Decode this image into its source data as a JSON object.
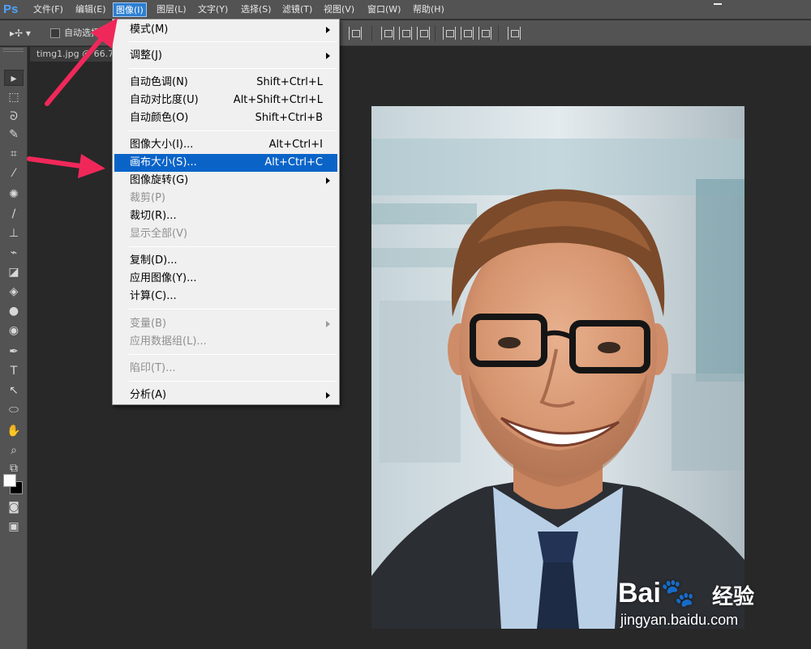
{
  "app": {
    "logo": "Ps"
  },
  "menubar": {
    "items": [
      {
        "label": "文件(F)"
      },
      {
        "label": "编辑(E)"
      },
      {
        "label": "图像(I)"
      },
      {
        "label": "图层(L)"
      },
      {
        "label": "文字(Y)"
      },
      {
        "label": "选择(S)"
      },
      {
        "label": "滤镜(T)"
      },
      {
        "label": "视图(V)"
      },
      {
        "label": "窗口(W)"
      },
      {
        "label": "帮助(H)"
      }
    ],
    "active_index": 2
  },
  "options_bar": {
    "tool_glyph": "▸✢ ▾",
    "auto_select_label": "自动选择"
  },
  "document_tab": {
    "label": "timg1.jpg @ 66.7%"
  },
  "image_menu": {
    "items": [
      {
        "label": "模式(M)",
        "shortcut": "",
        "submenu": true,
        "disabled": false
      },
      {
        "label": "调整(J)",
        "shortcut": "",
        "submenu": true,
        "disabled": false
      },
      {
        "label": "自动色调(N)",
        "shortcut": "Shift+Ctrl+L",
        "submenu": false,
        "disabled": false
      },
      {
        "label": "自动对比度(U)",
        "shortcut": "Alt+Shift+Ctrl+L",
        "submenu": false,
        "disabled": false
      },
      {
        "label": "自动颜色(O)",
        "shortcut": "Shift+Ctrl+B",
        "submenu": false,
        "disabled": false
      },
      {
        "label": "图像大小(I)...",
        "shortcut": "Alt+Ctrl+I",
        "submenu": false,
        "disabled": false
      },
      {
        "label": "画布大小(S)...",
        "shortcut": "Alt+Ctrl+C",
        "submenu": false,
        "disabled": false,
        "highlighted": true
      },
      {
        "label": "图像旋转(G)",
        "shortcut": "",
        "submenu": true,
        "disabled": false
      },
      {
        "label": "裁剪(P)",
        "shortcut": "",
        "submenu": false,
        "disabled": true
      },
      {
        "label": "裁切(R)...",
        "shortcut": "",
        "submenu": false,
        "disabled": false
      },
      {
        "label": "显示全部(V)",
        "shortcut": "",
        "submenu": false,
        "disabled": true
      },
      {
        "label": "复制(D)...",
        "shortcut": "",
        "submenu": false,
        "disabled": false
      },
      {
        "label": "应用图像(Y)...",
        "shortcut": "",
        "submenu": false,
        "disabled": false
      },
      {
        "label": "计算(C)...",
        "shortcut": "",
        "submenu": false,
        "disabled": false
      },
      {
        "label": "变量(B)",
        "shortcut": "",
        "submenu": true,
        "disabled": true
      },
      {
        "label": "应用数据组(L)...",
        "shortcut": "",
        "submenu": false,
        "disabled": true
      },
      {
        "label": "陷印(T)...",
        "shortcut": "",
        "submenu": false,
        "disabled": true
      },
      {
        "label": "分析(A)",
        "shortcut": "",
        "submenu": true,
        "disabled": false
      }
    ]
  },
  "tools": [
    {
      "name": "move-tool-icon",
      "glyph": "▸"
    },
    {
      "name": "marquee-tool-icon",
      "glyph": "⬚"
    },
    {
      "name": "lasso-tool-icon",
      "glyph": "ᘐ"
    },
    {
      "name": "quick-select-tool-icon",
      "glyph": "✎"
    },
    {
      "name": "crop-tool-icon",
      "glyph": "⌗"
    },
    {
      "name": "eyedropper-tool-icon",
      "glyph": "⁄"
    },
    {
      "name": "healing-brush-icon",
      "glyph": "✺"
    },
    {
      "name": "brush-tool-icon",
      "glyph": "∕"
    },
    {
      "name": "stamp-tool-icon",
      "glyph": "⊥"
    },
    {
      "name": "history-brush-icon",
      "glyph": "⌁"
    },
    {
      "name": "eraser-tool-icon",
      "glyph": "◪"
    },
    {
      "name": "paint-bucket-icon",
      "glyph": "◈"
    },
    {
      "name": "blur-tool-icon",
      "glyph": "●"
    },
    {
      "name": "dodge-tool-icon",
      "glyph": "◉"
    },
    {
      "name": "pen-tool-icon",
      "glyph": "✒"
    },
    {
      "name": "type-tool-icon",
      "glyph": "T"
    },
    {
      "name": "path-select-icon",
      "glyph": "↖"
    },
    {
      "name": "ellipse-tool-icon",
      "glyph": "⬭"
    },
    {
      "name": "hand-tool-icon",
      "glyph": "✋"
    },
    {
      "name": "zoom-tool-icon",
      "glyph": "⌕"
    },
    {
      "name": "default-colors-icon",
      "glyph": "⧉"
    },
    {
      "name": "quick-mask-icon",
      "glyph": "◙"
    },
    {
      "name": "screen-mode-icon",
      "glyph": "▣"
    }
  ],
  "watermark": {
    "brand": "Bai",
    "brand_suffix": "经验",
    "url": "jingyan.baidu.com"
  },
  "colors": {
    "accent": "#0a64c8",
    "annotation_arrow": "#f0285a"
  }
}
